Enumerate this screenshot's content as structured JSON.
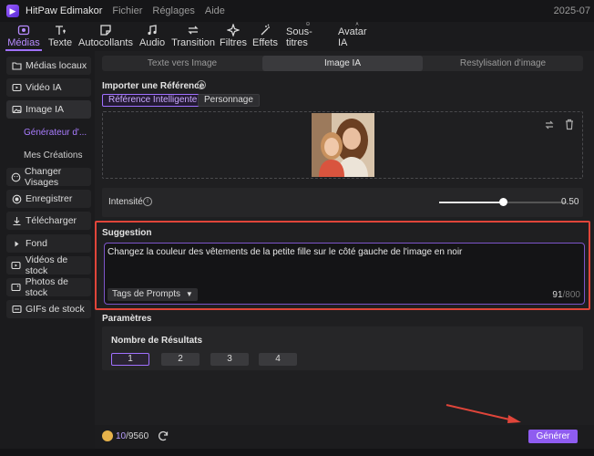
{
  "titlebar": {
    "app_title": "HitPaw Edimakor",
    "menu": [
      "Fichier",
      "Réglages",
      "Aide"
    ],
    "date": "2025-07"
  },
  "toolbar": {
    "items": [
      {
        "label": "Médias",
        "icon": "media-icon"
      },
      {
        "label": "Texte",
        "icon": "text-icon"
      },
      {
        "label": "Autocollants",
        "icon": "sticker-icon"
      },
      {
        "label": "Audio",
        "icon": "music-icon"
      },
      {
        "label": "Transition",
        "icon": "transition-icon"
      },
      {
        "label": "Filtres",
        "icon": "filter-icon"
      },
      {
        "label": "Effets",
        "icon": "effects-icon"
      },
      {
        "label": "Sous-titres",
        "icon": "subtitles-icon"
      },
      {
        "label": "Avatar IA",
        "icon": "avatar-icon"
      }
    ],
    "active": "Médias",
    "accent": "#a070ff"
  },
  "sidebar": {
    "items": [
      {
        "label": "Médias locaux",
        "icon": "folder-icon"
      },
      {
        "label": "Vidéo IA",
        "icon": "video-icon"
      },
      {
        "label": "Image IA",
        "icon": "image-icon"
      },
      {
        "label": "Changer Visages",
        "icon": "face-icon"
      },
      {
        "label": "Enregistrer",
        "icon": "record-icon"
      },
      {
        "label": "Télécharger",
        "icon": "download-icon"
      },
      {
        "label": "Fond",
        "icon": "play-icon"
      },
      {
        "label": "Vidéos de stock",
        "icon": "stock-video-icon"
      },
      {
        "label": "Photos de stock",
        "icon": "stock-photo-icon"
      },
      {
        "label": "GIFs de stock",
        "icon": "gif-icon"
      }
    ],
    "subitems": [
      "Générateur d'...",
      "Mes Créations"
    ],
    "active": "Image IA"
  },
  "tabs": [
    "Texte vers Image",
    "Image IA",
    "Restylisation d'image"
  ],
  "active_tab": "Image IA",
  "reference": {
    "title": "Importer une Référence",
    "buttons": [
      "Référence Intelligente",
      "Personnage"
    ],
    "active": "Référence Intelligente"
  },
  "intensity": {
    "label": "Intensité",
    "value": "0.50",
    "level": 0.5
  },
  "suggestion": {
    "title": "Suggestion",
    "text": "Changez la couleur des vêtements de la petite fille sur le côté gauche de l'image en noir",
    "tags_label": "Tags de Prompts",
    "count": "91",
    "max": "/800"
  },
  "params": {
    "title": "Paramètres",
    "results_label": "Nombre de Résultats",
    "options": [
      "1",
      "2",
      "3",
      "4"
    ],
    "selected": "1"
  },
  "bottom": {
    "credits_used": "10",
    "credits_total": "/9560",
    "generate_label": "Générer"
  },
  "colors": {
    "highlight_border": "#e0453a",
    "generate_button": "#8f5cf0"
  }
}
